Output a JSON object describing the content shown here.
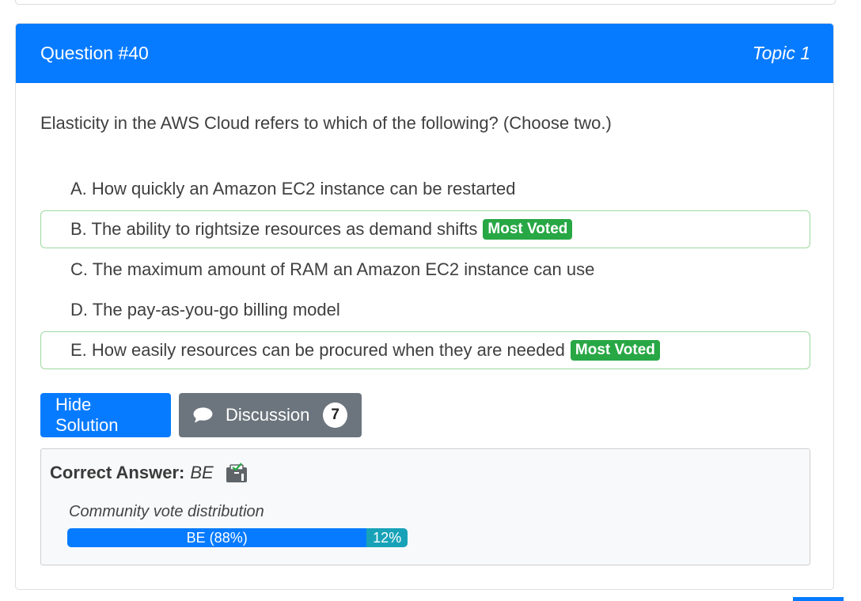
{
  "question": {
    "title": "Question #40",
    "topic": "Topic 1",
    "text": "Elasticity in the AWS Cloud refers to which of the following? (Choose two.)"
  },
  "choices": [
    {
      "text": "A. How quickly an Amazon EC2 instance can be restarted",
      "badge": ""
    },
    {
      "text": "B. The ability to rightsize resources as demand shifts",
      "badge": "Most Voted"
    },
    {
      "text": "C. The maximum amount of RAM an Amazon EC2 instance can use",
      "badge": ""
    },
    {
      "text": "D. The pay-as-you-go billing model",
      "badge": ""
    },
    {
      "text": "E. How easily resources can be procured when they are needed",
      "badge": "Most Voted"
    }
  ],
  "buttons": {
    "hide_solution": "Hide Solution",
    "discussion": "Discussion",
    "discussion_count": "7"
  },
  "answer": {
    "label": "Correct Answer:",
    "value": "BE",
    "icon": "verified-clipboard-icon"
  },
  "vote_distribution": {
    "title": "Community vote distribution",
    "segments": [
      {
        "label": "BE (88%)",
        "percent": 88,
        "color": "#077bff"
      },
      {
        "label": "12%",
        "percent": 12,
        "color": "#17a2b8"
      }
    ]
  },
  "colors": {
    "header_bg": "#077bff",
    "most_voted_badge": "#28a745",
    "voted_border": "#9fd9a0",
    "discussion_button": "#6c757d"
  }
}
